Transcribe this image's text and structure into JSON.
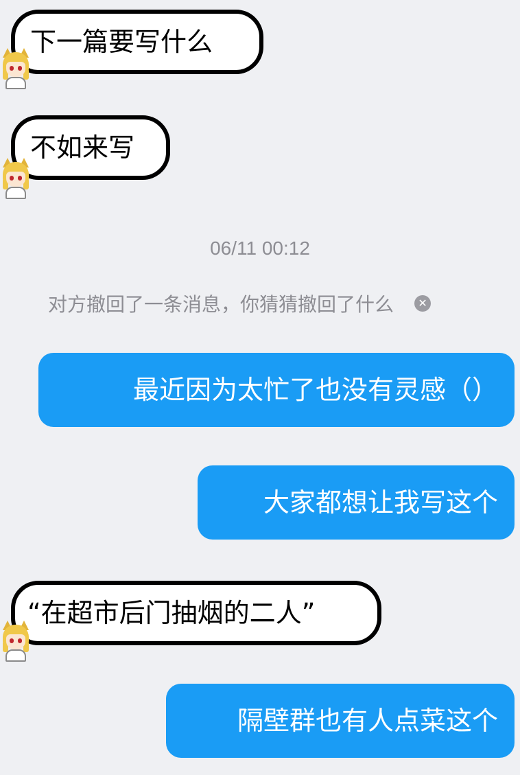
{
  "messages": {
    "m1": {
      "text": "下一篇要写什么"
    },
    "m2": {
      "text": "不如来写"
    },
    "timestamp": "06/11 00:12",
    "recall_notice": "对方撤回了一条消息，你猜猜撤回了什么",
    "m3": {
      "text": "最近因为太忙了也没有灵感（）"
    },
    "m4": {
      "text": "大家都想让我写这个"
    },
    "m5": {
      "text": "“在超市后门抽烟的二人”"
    },
    "m6": {
      "text": "隔壁群也有人点菜这个"
    }
  },
  "icons": {
    "avatar": "cat-girl-avatar-icon",
    "dismiss": "close-icon"
  },
  "colors": {
    "background": "#eff0f3",
    "outgoing_bubble": "#1a9cf5",
    "incoming_bubble": "#ffffff",
    "meta_text": "#8d8d93"
  }
}
